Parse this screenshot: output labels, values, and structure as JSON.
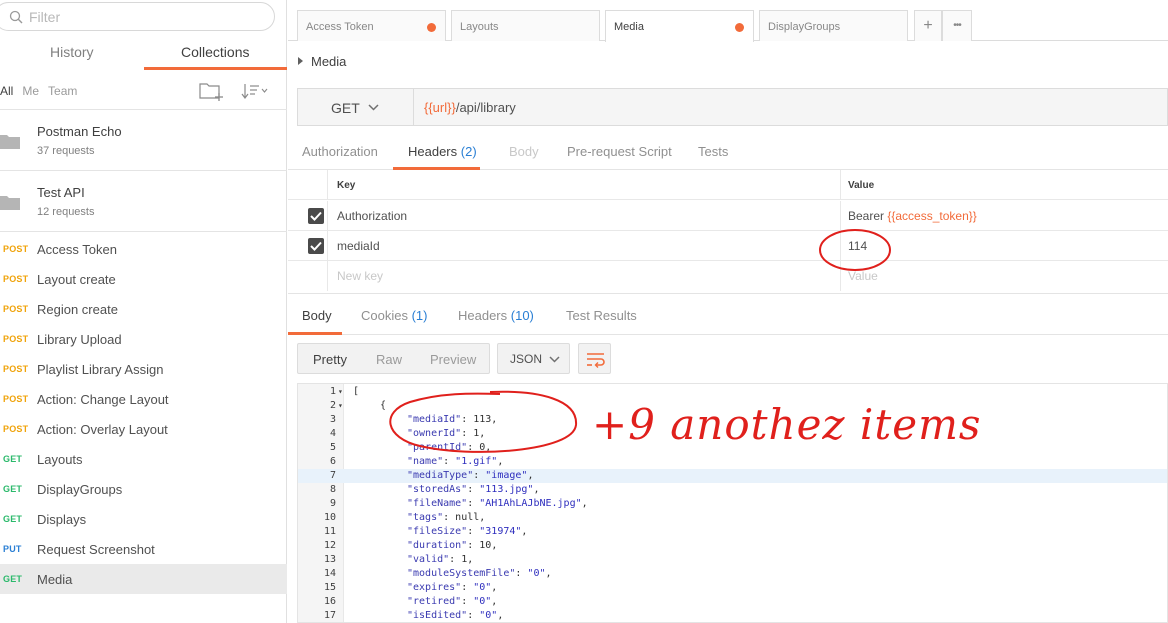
{
  "sidebar": {
    "filter_placeholder": "Filter",
    "tabs": [
      {
        "label": "History"
      },
      {
        "label": "Collections"
      }
    ],
    "scopes": [
      {
        "label": "All"
      },
      {
        "label": "Me"
      },
      {
        "label": "Team"
      }
    ],
    "collections": [
      {
        "name": "Postman Echo",
        "count": "37 requests"
      },
      {
        "name": "Test API",
        "count": "12 requests"
      }
    ],
    "requests": [
      {
        "method": "POST",
        "name": "Access Token"
      },
      {
        "method": "POST",
        "name": "Layout create"
      },
      {
        "method": "POST",
        "name": "Region create"
      },
      {
        "method": "POST",
        "name": "Library Upload"
      },
      {
        "method": "POST",
        "name": "Playlist Library Assign"
      },
      {
        "method": "POST",
        "name": "Action: Change Layout"
      },
      {
        "method": "POST",
        "name": "Action: Overlay Layout"
      },
      {
        "method": "GET",
        "name": "Layouts"
      },
      {
        "method": "GET",
        "name": "DisplayGroups"
      },
      {
        "method": "GET",
        "name": "Displays"
      },
      {
        "method": "PUT",
        "name": "Request Screenshot"
      },
      {
        "method": "GET",
        "name": "Media",
        "active": true
      }
    ]
  },
  "tabs": [
    {
      "label": "Access Token",
      "unsaved": true
    },
    {
      "label": "Layouts",
      "unsaved": false
    },
    {
      "label": "Media",
      "unsaved": true,
      "active": true
    },
    {
      "label": "DisplayGroups",
      "unsaved": false
    }
  ],
  "tab_buttons": {
    "add": "+",
    "more": "•••"
  },
  "request": {
    "title": "Media",
    "method": "GET",
    "url_var": "{{url}}",
    "url_path": "/api/library"
  },
  "request_tabs": {
    "authorization": "Authorization",
    "headers": "Headers",
    "headers_count": "(2)",
    "body": "Body",
    "prerequest": "Pre-request Script",
    "tests": "Tests"
  },
  "headers_table": {
    "key_header": "Key",
    "value_header": "Value",
    "rows": [
      {
        "key": "Authorization",
        "value_prefix": "Bearer ",
        "value_var": "{{access_token}}",
        "checked": true
      },
      {
        "key": "mediaId",
        "value_prefix": "114",
        "value_var": "",
        "checked": true
      }
    ],
    "new_key_placeholder": "New key",
    "new_value_placeholder": "Value"
  },
  "response_tabs": {
    "body": "Body",
    "cookies": "Cookies",
    "cookies_count": "(1)",
    "headers": "Headers",
    "headers_count": "(10)",
    "test_results": "Test Results"
  },
  "view": {
    "modes": [
      "Pretty",
      "Raw",
      "Preview"
    ],
    "format": "JSON"
  },
  "code_lines": [
    {
      "n": "1",
      "fold": true,
      "indent": 0,
      "parts": [
        [
          "p",
          "["
        ]
      ]
    },
    {
      "n": "2",
      "fold": true,
      "indent": 1,
      "parts": [
        [
          "p",
          "{"
        ]
      ]
    },
    {
      "n": "3",
      "indent": 2,
      "parts": [
        [
          "k",
          "\"mediaId\""
        ],
        [
          "p",
          ": "
        ],
        [
          "n",
          "113"
        ],
        [
          "p",
          ","
        ]
      ]
    },
    {
      "n": "4",
      "indent": 2,
      "parts": [
        [
          "k",
          "\"ownerId\""
        ],
        [
          "p",
          ": "
        ],
        [
          "n",
          "1"
        ],
        [
          "p",
          ","
        ]
      ]
    },
    {
      "n": "5",
      "indent": 2,
      "parts": [
        [
          "k",
          "\"parentId\""
        ],
        [
          "p",
          ": "
        ],
        [
          "n",
          "0"
        ],
        [
          "p",
          ","
        ]
      ]
    },
    {
      "n": "6",
      "indent": 2,
      "parts": [
        [
          "k",
          "\"name\""
        ],
        [
          "p",
          ": "
        ],
        [
          "s",
          "\"1.gif\""
        ],
        [
          "p",
          ","
        ]
      ]
    },
    {
      "n": "7",
      "indent": 2,
      "hl": true,
      "parts": [
        [
          "k",
          "\"mediaType\""
        ],
        [
          "p",
          ": "
        ],
        [
          "s",
          "\"image\""
        ],
        [
          "p",
          ","
        ]
      ]
    },
    {
      "n": "8",
      "indent": 2,
      "parts": [
        [
          "k",
          "\"storedAs\""
        ],
        [
          "p",
          ": "
        ],
        [
          "s",
          "\"113.jpg\""
        ],
        [
          "p",
          ","
        ]
      ]
    },
    {
      "n": "9",
      "indent": 2,
      "parts": [
        [
          "k",
          "\"fileName\""
        ],
        [
          "p",
          ": "
        ],
        [
          "s",
          "\"AH1AhLAJbNE.jpg\""
        ],
        [
          "p",
          ","
        ]
      ]
    },
    {
      "n": "10",
      "indent": 2,
      "parts": [
        [
          "k",
          "\"tags\""
        ],
        [
          "p",
          ": "
        ],
        [
          "n",
          "null"
        ],
        [
          "p",
          ","
        ]
      ]
    },
    {
      "n": "11",
      "indent": 2,
      "parts": [
        [
          "k",
          "\"fileSize\""
        ],
        [
          "p",
          ": "
        ],
        [
          "s",
          "\"31974\""
        ],
        [
          "p",
          ","
        ]
      ]
    },
    {
      "n": "12",
      "indent": 2,
      "parts": [
        [
          "k",
          "\"duration\""
        ],
        [
          "p",
          ": "
        ],
        [
          "n",
          "10"
        ],
        [
          "p",
          ","
        ]
      ]
    },
    {
      "n": "13",
      "indent": 2,
      "parts": [
        [
          "k",
          "\"valid\""
        ],
        [
          "p",
          ": "
        ],
        [
          "n",
          "1"
        ],
        [
          "p",
          ","
        ]
      ]
    },
    {
      "n": "14",
      "indent": 2,
      "parts": [
        [
          "k",
          "\"moduleSystemFile\""
        ],
        [
          "p",
          ": "
        ],
        [
          "s",
          "\"0\""
        ],
        [
          "p",
          ","
        ]
      ]
    },
    {
      "n": "15",
      "indent": 2,
      "parts": [
        [
          "k",
          "\"expires\""
        ],
        [
          "p",
          ": "
        ],
        [
          "s",
          "\"0\""
        ],
        [
          "p",
          ","
        ]
      ]
    },
    {
      "n": "16",
      "indent": 2,
      "parts": [
        [
          "k",
          "\"retired\""
        ],
        [
          "p",
          ": "
        ],
        [
          "s",
          "\"0\""
        ],
        [
          "p",
          ","
        ]
      ]
    },
    {
      "n": "17",
      "indent": 2,
      "parts": [
        [
          "k",
          "\"isEdited\""
        ],
        [
          "p",
          ": "
        ],
        [
          "s",
          "\"0\""
        ],
        [
          "p",
          ","
        ]
      ]
    }
  ],
  "annotation": {
    "text": "+9 anothez items",
    "color": "#e0201c"
  },
  "colors": {
    "accent": "#f26b3a",
    "post": "#f0a30a",
    "get": "#2bb96b",
    "put": "#2a7fd4",
    "count": "#2a7fd4"
  }
}
